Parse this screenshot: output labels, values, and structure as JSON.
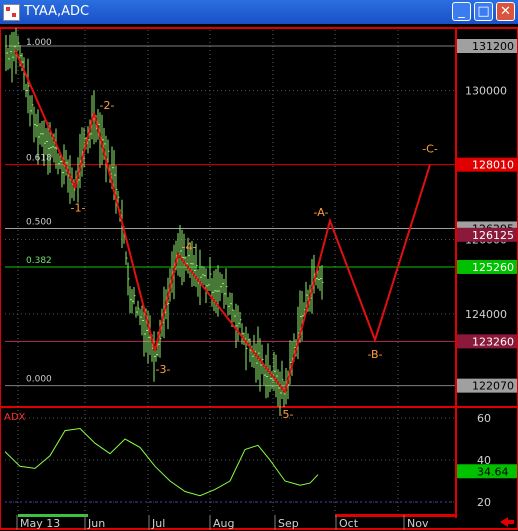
{
  "window": {
    "title": "TYAA,ADC",
    "minimize_icon": "minimize-icon",
    "maximize_icon": "maximize-icon",
    "close_icon": "close-icon",
    "minimize_glyph": "_",
    "maximize_glyph": "□",
    "close_glyph": "✕"
  },
  "colors": {
    "wave": "#e01010",
    "wave_label": "#ffa040",
    "fib_label": "#cccccc",
    "adx_line": "#88ff44",
    "price_bars": "#90ee70",
    "badge_red": "#e00000",
    "badge_maroon": "#8b1a3a",
    "badge_gray": "#a0a0a0",
    "badge_green": "#00c000"
  },
  "price_axis": {
    "ticks": [
      "130000",
      "126000",
      "124000"
    ],
    "badges": [
      {
        "label": "131200",
        "value": 131200,
        "style": "gray"
      },
      {
        "label": "128010",
        "value": 128010,
        "style": "red"
      },
      {
        "label": "126295",
        "value": 126295,
        "style": "gray"
      },
      {
        "label": "126125",
        "value": 126125,
        "style": "maroon"
      },
      {
        "label": "125260",
        "value": 125260,
        "style": "green"
      },
      {
        "label": "123260",
        "value": 123260,
        "style": "maroon"
      },
      {
        "label": "122070",
        "value": 122070,
        "style": "gray"
      }
    ]
  },
  "fib_levels": [
    {
      "label": "1.000",
      "value": 131200,
      "color": "#808080"
    },
    {
      "label": "0.618",
      "value": 128010,
      "color": "#e00000"
    },
    {
      "label": "0.500",
      "value": 126295,
      "color": "#a0a0a0"
    },
    {
      "label": "0.382",
      "value": 125260,
      "color": "#10c010"
    },
    {
      "label": "",
      "value": 123260,
      "color": "#b03050"
    },
    {
      "label": "0.000",
      "value": 122070,
      "color": "#808080"
    }
  ],
  "wave_labels": [
    "-1-",
    "-2-",
    "-3-",
    "-4-",
    "-5-",
    "-A-",
    "-B-",
    "-C-"
  ],
  "adx": {
    "title": "ADX",
    "ticks": [
      "60",
      "40",
      "20"
    ],
    "badge": "34.64",
    "badge_value": 34.64
  },
  "x_axis": {
    "labels": [
      "May 13",
      "Jun",
      "Jul",
      "Aug",
      "Sep",
      "Oct",
      "Nov"
    ]
  }
}
